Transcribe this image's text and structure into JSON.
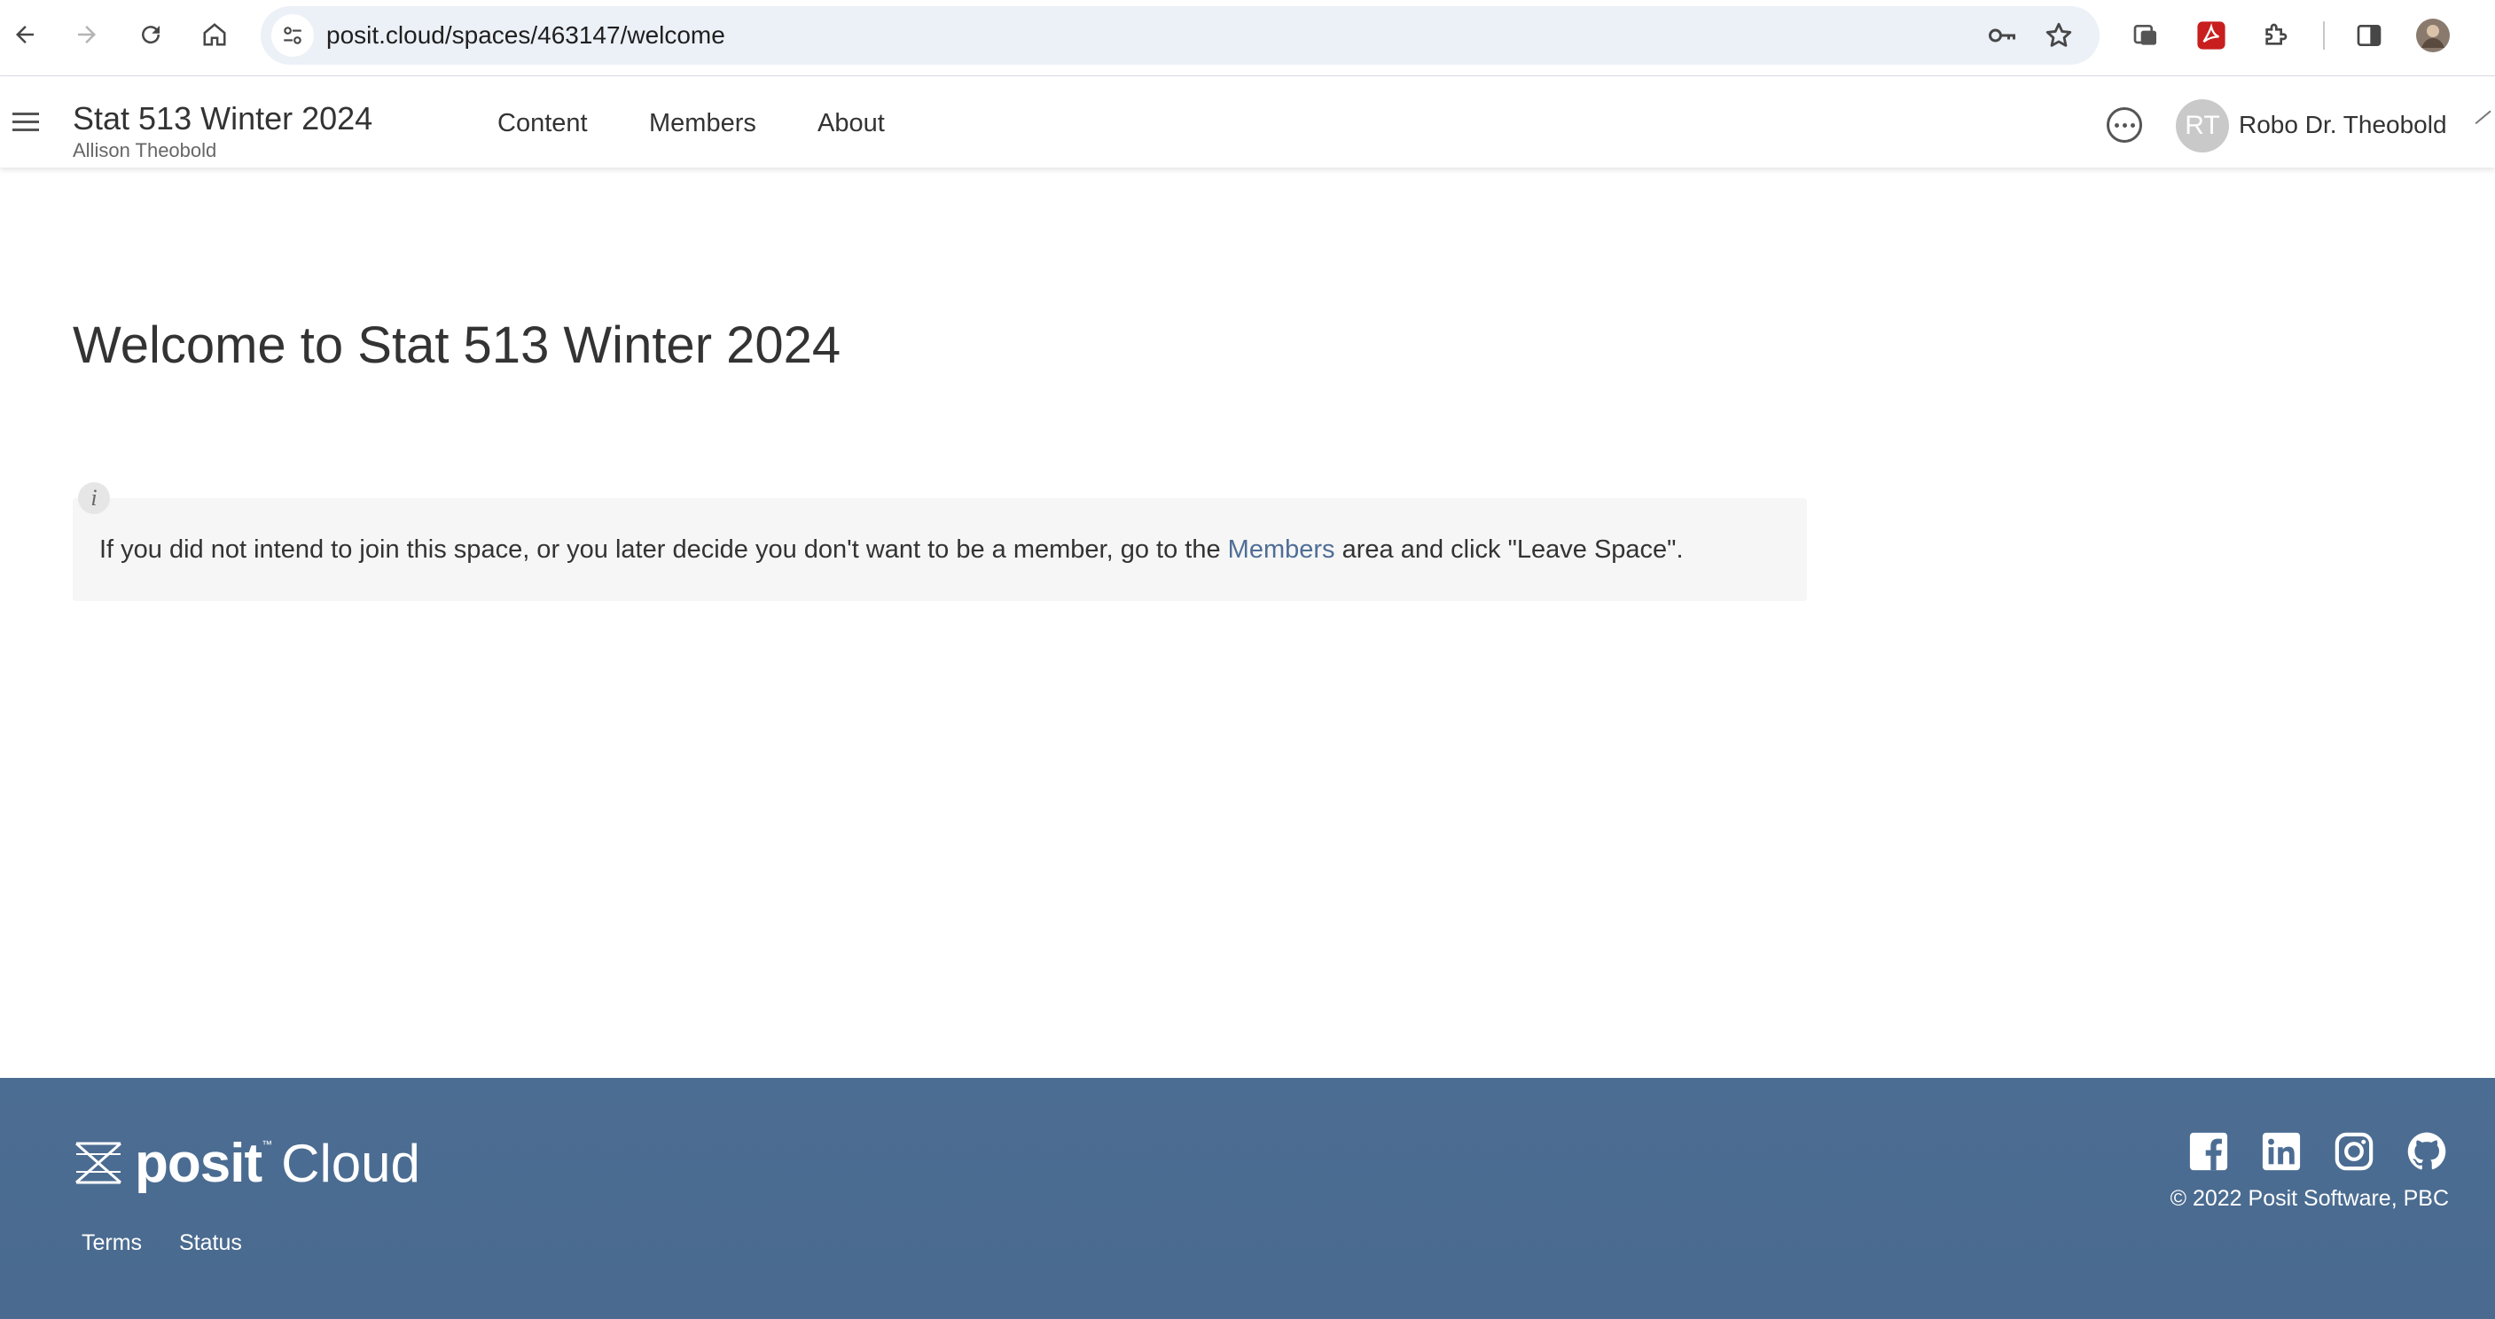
{
  "browser": {
    "url": "posit.cloud/spaces/463147/welcome"
  },
  "header": {
    "space_title": "Stat 513 Winter 2024",
    "space_owner": "Allison Theobold",
    "tabs": [
      {
        "label": "Content"
      },
      {
        "label": "Members"
      },
      {
        "label": "About"
      }
    ],
    "user": {
      "initials": "RT",
      "name": "Robo Dr. Theobold"
    }
  },
  "main": {
    "title": "Welcome to Stat 513 Winter 2024",
    "info": {
      "badge": "i",
      "text_before": "If you did not intend to join this space, or you later decide you don't want to be a member, go to the ",
      "link": "Members",
      "text_after": " area and click \"Leave Space\"."
    }
  },
  "footer": {
    "brand": "posit",
    "brand_tm": "™",
    "product": "Cloud",
    "links": [
      {
        "label": "Terms"
      },
      {
        "label": "Status"
      }
    ],
    "social_icons": [
      "facebook-icon",
      "linkedin-icon",
      "instagram-icon",
      "github-icon"
    ],
    "copyright": "© 2022 Posit Software, PBC"
  },
  "colors": {
    "footer_bg": "#4c6d93",
    "link": "#4f6e96",
    "omnibox_bg": "#ecf0f7",
    "info_bg": "#f6f6f6"
  }
}
